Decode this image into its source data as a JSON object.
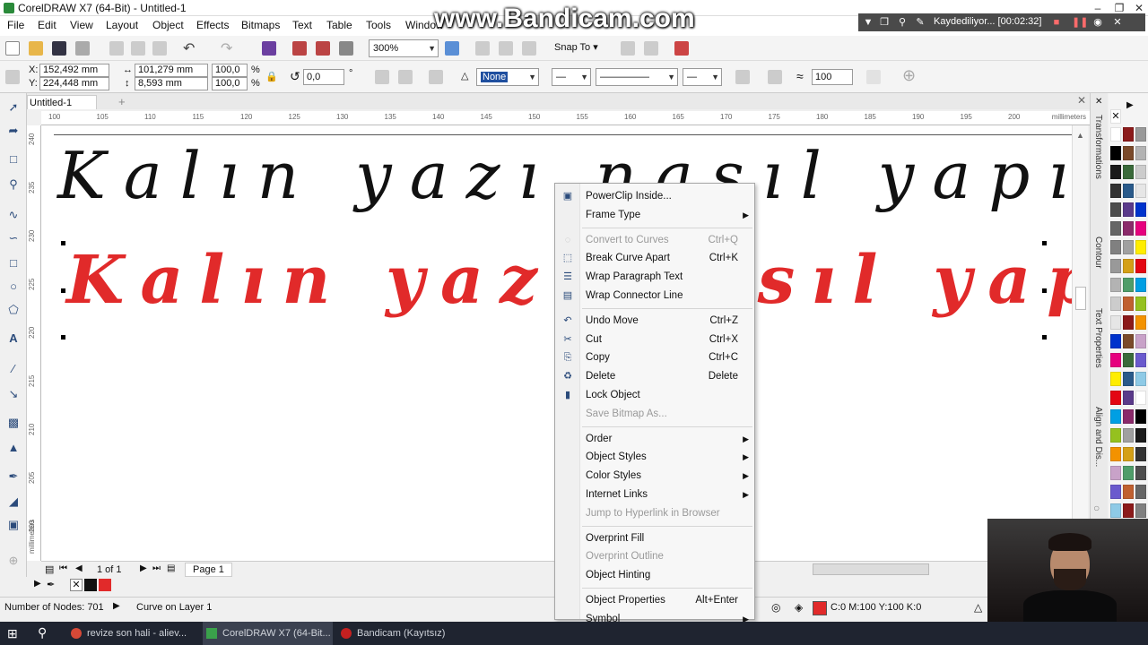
{
  "window": {
    "title": "CorelDRAW X7 (64-Bit) - Untitled-1"
  },
  "watermark": "www.Bandicam.com",
  "recorder": {
    "status": "Kaydediliyor... [00:02:32]"
  },
  "menubar": [
    "File",
    "Edit",
    "View",
    "Layout",
    "Object",
    "Effects",
    "Bitmaps",
    "Text",
    "Table",
    "Tools",
    "Window"
  ],
  "toolbar": {
    "zoom": "300%",
    "snap_to": "Snap To"
  },
  "propbar": {
    "x": "152,492 mm",
    "y": "224,448 mm",
    "width": "101,279 mm",
    "height": "8,593 mm",
    "scale_x": "100,0",
    "scale_y": "100,0",
    "pct": "%",
    "angle": "0,0",
    "deg": "°",
    "outline": "None",
    "smooth": "100"
  },
  "doc_tab": "Untitled-1",
  "ruler": {
    "h_ticks": [
      "100",
      "105",
      "110",
      "115",
      "120",
      "125",
      "130",
      "135",
      "140",
      "145",
      "150",
      "155",
      "160",
      "165",
      "170",
      "175",
      "180",
      "185",
      "190",
      "195",
      "200"
    ],
    "h_unit": "millimeters",
    "v_ticks": [
      "240",
      "235",
      "230",
      "225",
      "220",
      "215",
      "210",
      "205",
      "200"
    ],
    "v_unit": "millimeters"
  },
  "canvas": {
    "text_black": "Kalın yazı nasıl yapılır",
    "text_red": "Kalın yazı nasıl yapılır",
    "red_color": "#e12a2a"
  },
  "pagebar": {
    "page_info": "1 of 1",
    "page_tab": "Page 1"
  },
  "status": {
    "nodes": "Number of Nodes: 701",
    "layer": "Curve on Layer 1",
    "fill": "C:0 M:100 Y:100 K:0"
  },
  "dock_tabs": [
    "Transformations",
    "Contour",
    "Text Properties",
    "Align and Dis..."
  ],
  "context_menu": {
    "items": [
      {
        "label": "PowerClip Inside...",
        "shortcut": "",
        "submenu": false,
        "disabled": false,
        "icon": "powerclip-icon"
      },
      {
        "label": "Frame Type",
        "shortcut": "",
        "submenu": true,
        "disabled": false,
        "icon": ""
      },
      {
        "sep": true
      },
      {
        "label": "Convert to Curves",
        "shortcut": "Ctrl+Q",
        "submenu": false,
        "disabled": true,
        "icon": "convert-curves-icon"
      },
      {
        "label": "Break Curve Apart",
        "shortcut": "Ctrl+K",
        "submenu": false,
        "disabled": false,
        "icon": "break-apart-icon"
      },
      {
        "label": "Wrap Paragraph Text",
        "shortcut": "",
        "submenu": false,
        "disabled": false,
        "icon": "wrap-text-icon"
      },
      {
        "label": "Wrap Connector Line",
        "shortcut": "",
        "submenu": false,
        "disabled": false,
        "icon": "wrap-connector-icon"
      },
      {
        "sep": true
      },
      {
        "label": "Undo Move",
        "shortcut": "Ctrl+Z",
        "submenu": false,
        "disabled": false,
        "icon": "undo-icon"
      },
      {
        "label": "Cut",
        "shortcut": "Ctrl+X",
        "submenu": false,
        "disabled": false,
        "icon": "scissors-icon"
      },
      {
        "label": "Copy",
        "shortcut": "Ctrl+C",
        "submenu": false,
        "disabled": false,
        "icon": "copy-icon"
      },
      {
        "label": "Delete",
        "shortcut": "Delete",
        "submenu": false,
        "disabled": false,
        "icon": "trash-icon"
      },
      {
        "label": "Lock Object",
        "shortcut": "",
        "submenu": false,
        "disabled": false,
        "icon": "lock-icon"
      },
      {
        "label": "Save Bitmap As...",
        "shortcut": "",
        "submenu": false,
        "disabled": true,
        "icon": ""
      },
      {
        "sep": true
      },
      {
        "label": "Order",
        "shortcut": "",
        "submenu": true,
        "disabled": false,
        "icon": ""
      },
      {
        "label": "Object Styles",
        "shortcut": "",
        "submenu": true,
        "disabled": false,
        "icon": ""
      },
      {
        "label": "Color Styles",
        "shortcut": "",
        "submenu": true,
        "disabled": false,
        "icon": ""
      },
      {
        "label": "Internet Links",
        "shortcut": "",
        "submenu": true,
        "disabled": false,
        "icon": ""
      },
      {
        "label": "Jump to Hyperlink in Browser",
        "shortcut": "",
        "submenu": false,
        "disabled": true,
        "icon": ""
      },
      {
        "sep": true
      },
      {
        "label": "Overprint Fill",
        "shortcut": "",
        "submenu": false,
        "disabled": false,
        "icon": ""
      },
      {
        "label": "Overprint Outline",
        "shortcut": "",
        "submenu": false,
        "disabled": true,
        "icon": ""
      },
      {
        "label": "Object Hinting",
        "shortcut": "",
        "submenu": false,
        "disabled": false,
        "icon": ""
      },
      {
        "sep": true
      },
      {
        "label": "Object Properties",
        "shortcut": "Alt+Enter",
        "submenu": false,
        "disabled": false,
        "icon": ""
      },
      {
        "label": "Symbol",
        "shortcut": "",
        "submenu": true,
        "disabled": false,
        "icon": ""
      }
    ]
  },
  "taskbar": [
    {
      "label": "revize son hali - aliev..."
    },
    {
      "label": "CorelDRAW X7 (64-Bit..."
    },
    {
      "label": "Bandicam (Kayıtsız)"
    }
  ],
  "palette_colors": [
    "#ffffff",
    "#000000",
    "#1a1a1a",
    "#333333",
    "#4d4d4d",
    "#666666",
    "#808080",
    "#999999",
    "#b3b3b3",
    "#cccccc",
    "#e6e6e6",
    "#0033cc",
    "#e6007e",
    "#ffed00",
    "#e30613",
    "#009fe3",
    "#95c11f",
    "#f39200",
    "#c8a2c8",
    "#6a5acd",
    "#8ecae6"
  ]
}
